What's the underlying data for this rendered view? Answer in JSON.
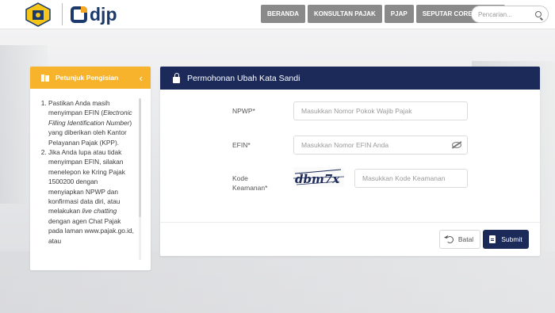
{
  "header": {
    "logo_brand": "djp",
    "nav": [
      {
        "label": "BERANDA"
      },
      {
        "label": "KONSULTAN PAJAK"
      },
      {
        "label": "PJAP"
      },
      {
        "label": "SEPUTAR CORETAX DJP"
      }
    ],
    "search_placeholder": "Pencarian..."
  },
  "guide": {
    "title": "Petunjuk Pengisian",
    "items_html": [
      "Pastikan Anda masih menyimpan EFIN (<i>Electronic Filling Identification Number</i>) yang diberikan oleh Kantor Pelayanan Pajak (KPP).",
      "Jika Anda lupa atau tidak menyimpan EFIN, silakan menelepon ke Kring Pajak 1500200 dengan menyiapkan NPWP dan konfirmasi data diri, atau melakukan <i>live chatting</i> dengan agen Chat Pajak pada laman www.pajak.go.id, atau"
    ]
  },
  "form": {
    "title": "Permohonan Ubah Kata Sandi",
    "npwp_label": "NPWP*",
    "npwp_placeholder": "Masukkan Nomor Pokok Wajib Pajak",
    "efin_label": "EFIN*",
    "efin_placeholder": "Masukkan Nomor EFIN Anda",
    "captcha_label_1": "Kode",
    "captcha_label_2": "Keamanan*",
    "captcha_text": "dbm7x",
    "captcha_placeholder": "Masukkan Kode Keamanan",
    "cancel_label": "Batal",
    "submit_label": "Submit"
  },
  "colors": {
    "header_navy": "#1c2a59",
    "guide_orange": "#f7b32b",
    "nav_gray": "#8a8a8a"
  }
}
